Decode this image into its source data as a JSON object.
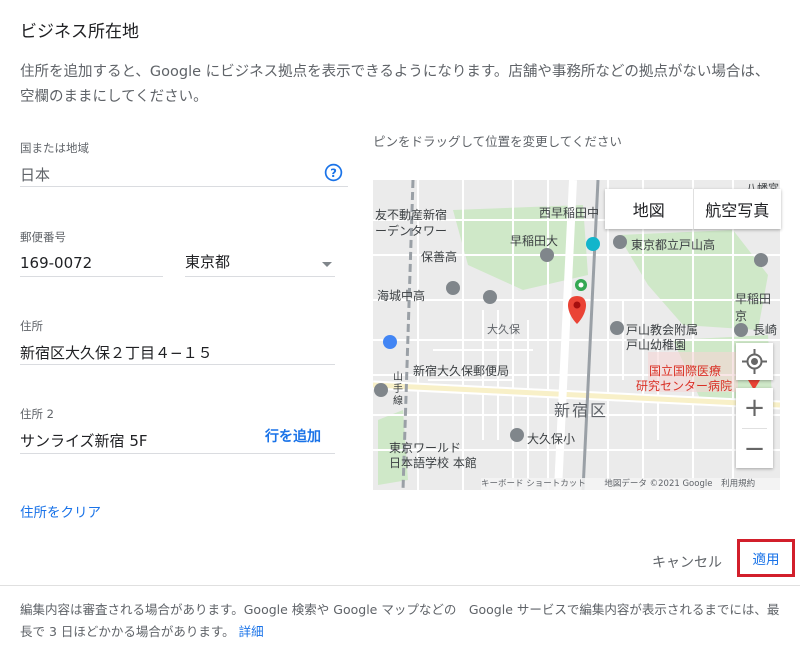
{
  "dialog": {
    "title": "ビジネス所在地",
    "description": "住所を追加すると、Google にビジネス拠点を表示できるようになります。店舗や事務所などの拠点がない場合は、空欄のままにしてください。"
  },
  "form": {
    "country_label": "国または地域",
    "country_value": "日本",
    "postal_label": "郵便番号",
    "postal_value": "169-0072",
    "prefecture_value": "東京都",
    "address_label": "住所",
    "address_value": "新宿区大久保２丁目４−１５",
    "address2_label": "住所 2",
    "address2_value": "サンライズ新宿 5F",
    "add_line_label": "行を追加",
    "clear_address_label": "住所をクリア"
  },
  "map": {
    "hint": "ピンをドラッグして位置を変更してください",
    "type_map": "地図",
    "type_satellite": "航空写真",
    "labels": {
      "l1": "友不動産新宿",
      "l2": "ーデンタワー",
      "l3": "西早稲田中",
      "l4": "早稲田大",
      "l5": "東京都立戸山高",
      "l6": "保善高",
      "l7": "海城中高",
      "l8": "早稲田京",
      "l9": "八幡宮",
      "l10": "大久保",
      "l11": "戸山教会附属",
      "l12": "戸山幼稚園",
      "l13": "長崎",
      "l14": "新宿大久保郵便局",
      "l15": "国立国際医療",
      "l16": "研究センター病院",
      "l17": "新宿区",
      "l18": "山手線",
      "l19": "大久保小",
      "l20": "東京ワールド",
      "l21": "日本語学校 本館",
      "l22": "キーボード ショートカット",
      "l23": "地図データ ©2021 Google",
      "l24": "利用規約"
    },
    "zoom_in": "+",
    "zoom_out": "−"
  },
  "actions": {
    "cancel": "キャンセル",
    "apply": "適用"
  },
  "footer": {
    "text": "編集内容は審査される場合があります。Google 検索や Google マップなどの　Google サービスで編集内容が表示されるまでには、最長で 3 日ほどかかる場合があります。",
    "link": "詳細"
  },
  "icons": {
    "help": "help-circle-icon",
    "dropdown": "dropdown-arrow-icon",
    "pin": "map-pin-icon",
    "location": "my-location-icon"
  },
  "colors": {
    "accent": "#1a73e8",
    "pin_red": "#ea4335",
    "pin_green": "#34a853",
    "highlight_box": "#d21f2b"
  }
}
